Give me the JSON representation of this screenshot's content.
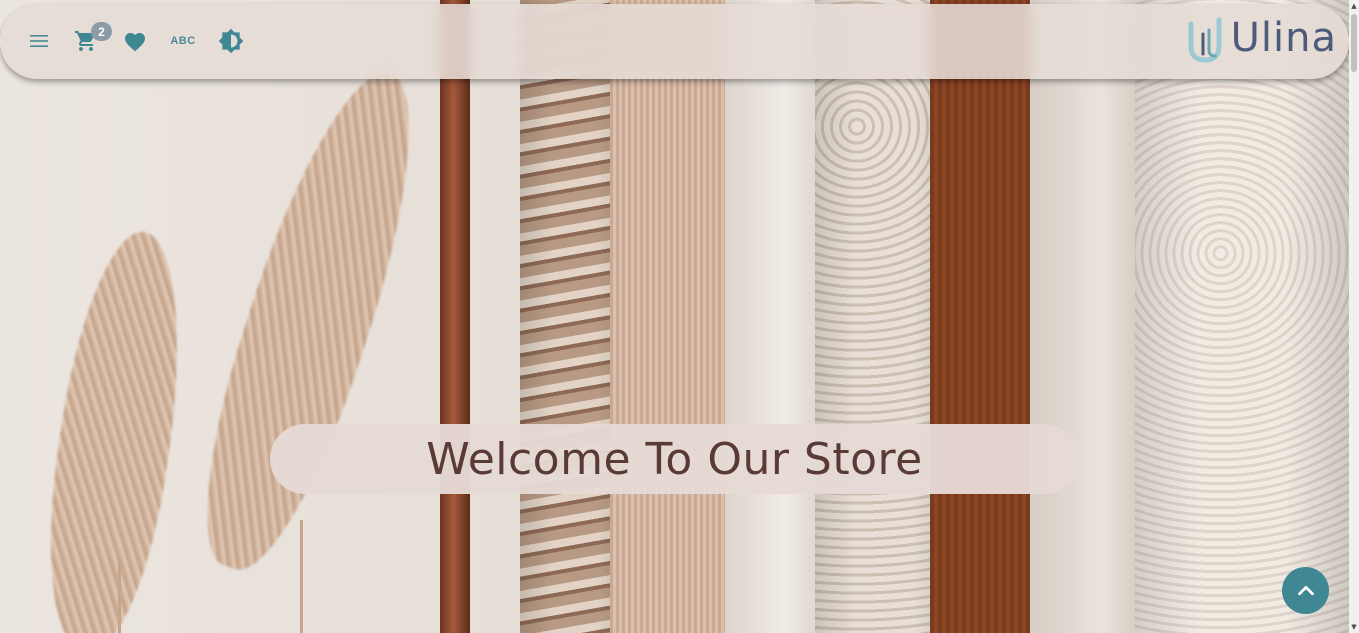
{
  "header": {
    "menu_icon": "hamburger-menu-icon",
    "cart_icon": "shopping-cart-icon",
    "cart_count": "2",
    "wishlist_icon": "heart-icon",
    "abc_label": "ABC",
    "theme_icon": "brightness-toggle-icon",
    "logo_text": "Ulina"
  },
  "hero": {
    "welcome_title": "Welcome To Our Store"
  },
  "back_to_top": {
    "icon": "chevron-up-icon"
  },
  "colors": {
    "accent": "#3f8793",
    "header_bg": "#e6dcd6",
    "title_text": "#5a3a34",
    "logo_text": "#4d5a7a",
    "badge_bg": "#8c9ba6"
  }
}
